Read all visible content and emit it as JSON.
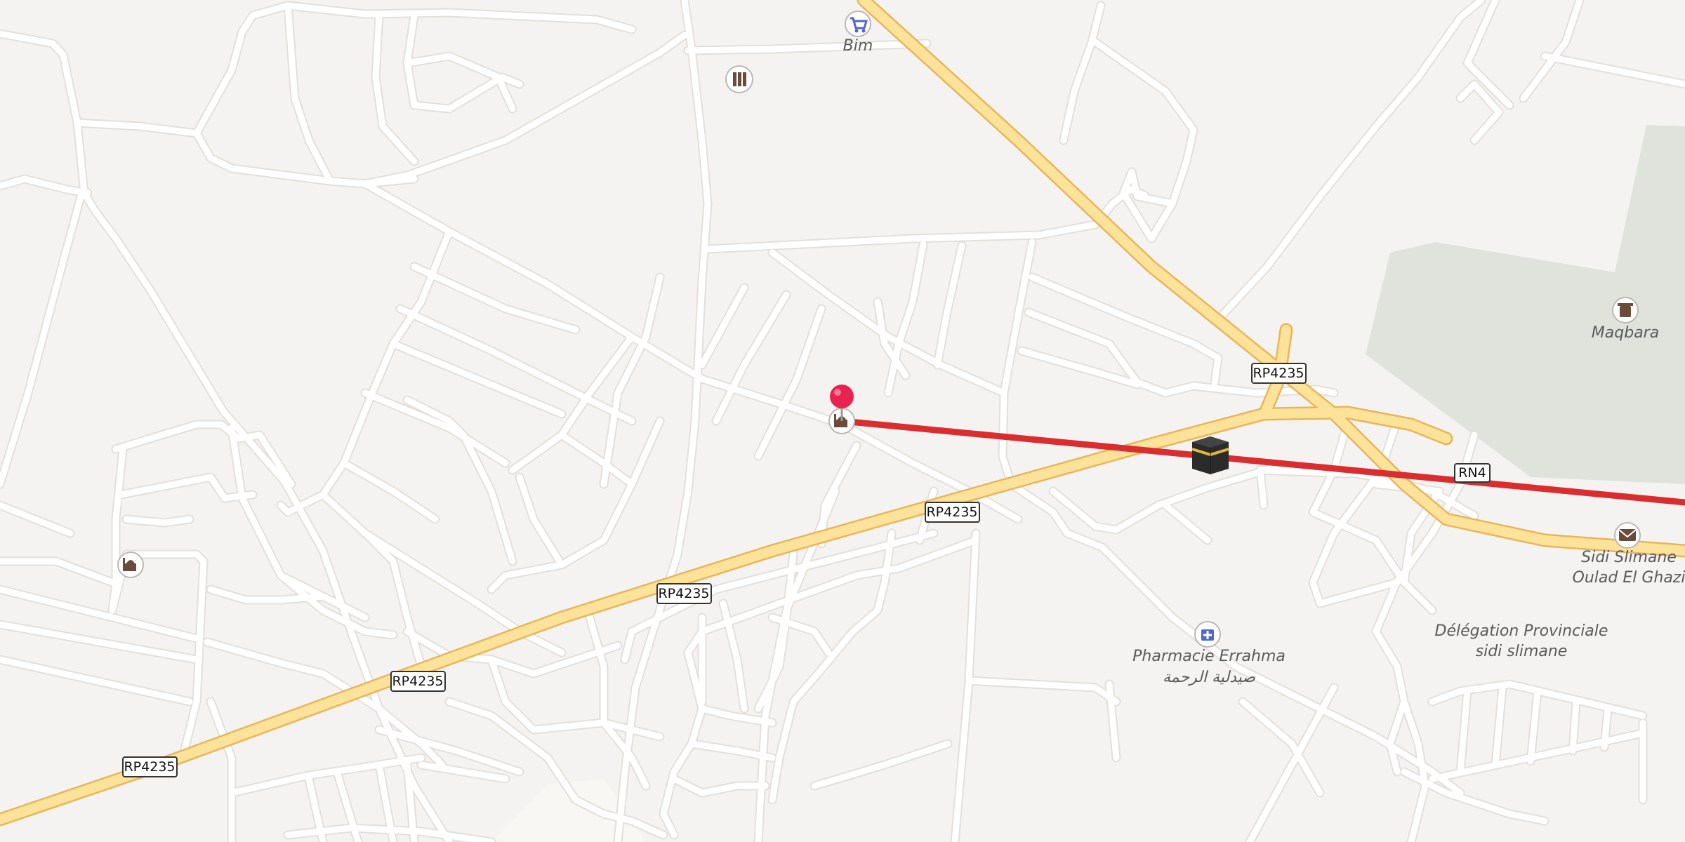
{
  "colors": {
    "background": "#f5f3f1",
    "street": "#ffffff",
    "main_road": "#fde29a",
    "main_road_casing": "#e8b65a",
    "route": "#d92d30",
    "pin": "#e8234f",
    "cemetery_area": "#dfe3dc",
    "water": "#9cc9f0"
  },
  "road_shields": {
    "rp4235_a": "RP4235",
    "rp4235_b": "RP4235",
    "rp4235_c": "RP4235",
    "rp4235_d": "RP4235",
    "rp4235_e": "RP4235",
    "rn4": "RN4"
  },
  "pois": {
    "bim": {
      "label": "Bim",
      "icon": "shopping-cart-icon"
    },
    "maqbara": {
      "label": "Maqbara",
      "icon": "cemetery-icon"
    },
    "post_office": {
      "label_line1": "Sidi Slimane",
      "label_line2": "Oulad El Ghazi",
      "icon": "envelope-icon"
    },
    "pharmacy": {
      "label_line1": "Pharmacie Errahma",
      "label_line2": "صيدلية الرحمة",
      "icon": "pharmacy-icon"
    },
    "delegation": {
      "label_line1": "Délégation Provinciale",
      "label_line2": "sidi slimane"
    },
    "library": {
      "icon": "library-icon"
    },
    "mosque_center": {
      "icon": "mosque-icon"
    },
    "mosque_west": {
      "icon": "mosque-icon"
    },
    "kaaba": {
      "icon": "kaaba-icon"
    }
  },
  "pin": {
    "icon": "map-pin-icon"
  }
}
